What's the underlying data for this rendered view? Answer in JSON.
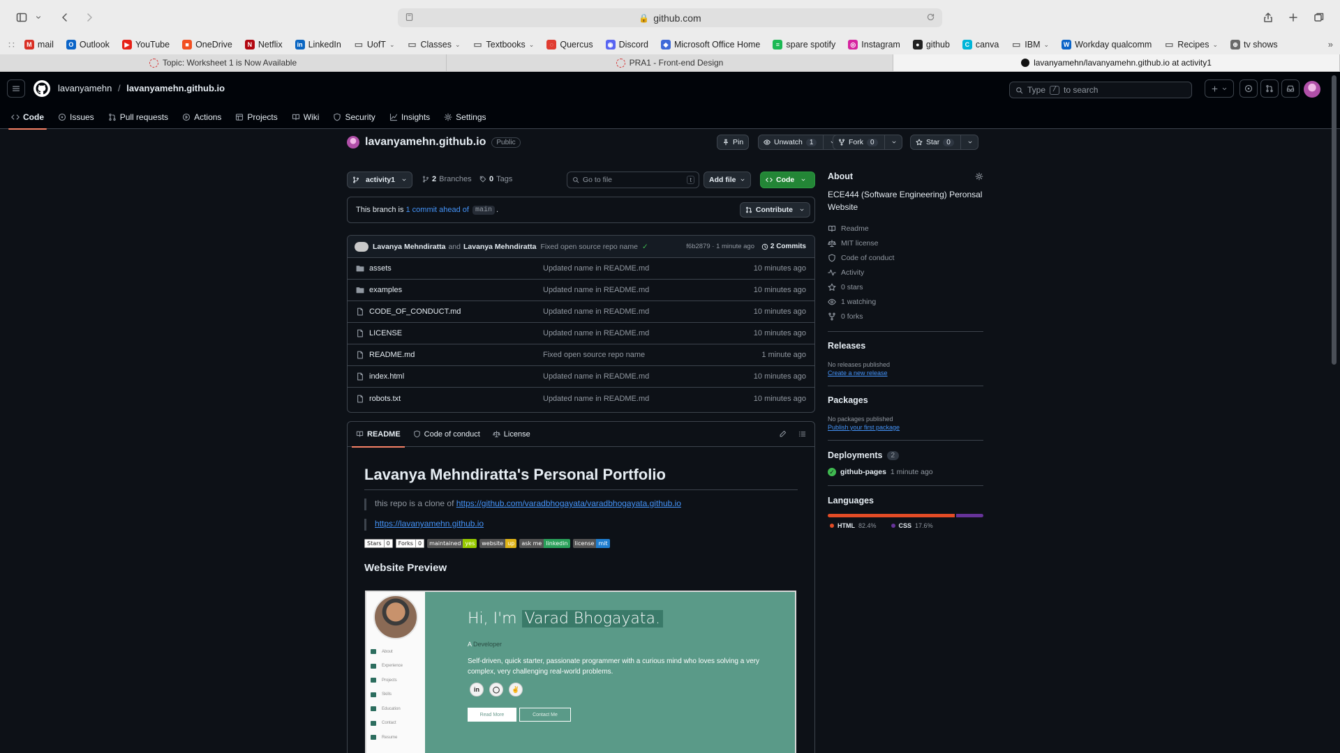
{
  "browser": {
    "address": "github.com",
    "bookmarks": [
      {
        "label": "mail",
        "color": "#d93025",
        "glyph": "M",
        "caret": false
      },
      {
        "label": "Outlook",
        "color": "#0a64c8",
        "glyph": "O",
        "caret": false
      },
      {
        "label": "YouTube",
        "color": "#e62117",
        "glyph": "▶",
        "caret": false
      },
      {
        "label": "OneDrive",
        "color": "#f25022",
        "glyph": "■",
        "caret": false
      },
      {
        "label": "Netflix",
        "color": "#b20710",
        "glyph": "N",
        "caret": false
      },
      {
        "label": "LinkedIn",
        "color": "#0a66c2",
        "glyph": "in",
        "caret": false
      },
      {
        "label": "UofT",
        "color": "#6a6a6a",
        "glyph": "▭",
        "caret": true
      },
      {
        "label": "Classes",
        "color": "#6a6a6a",
        "glyph": "▭",
        "caret": true
      },
      {
        "label": "Textbooks",
        "color": "#6a6a6a",
        "glyph": "▭",
        "caret": true
      },
      {
        "label": "Quercus",
        "color": "#e03c31",
        "glyph": "◌",
        "caret": false
      },
      {
        "label": "Discord",
        "color": "#5865f2",
        "glyph": "◉",
        "caret": false
      },
      {
        "label": "Microsoft Office Home",
        "color": "#3f6ad8",
        "glyph": "◆",
        "caret": false
      },
      {
        "label": "spare spotify",
        "color": "#1db954",
        "glyph": "≡",
        "caret": false
      },
      {
        "label": "Instagram",
        "color": "#d6249f",
        "glyph": "◎",
        "caret": false
      },
      {
        "label": "github",
        "color": "#222222",
        "glyph": "●",
        "caret": false
      },
      {
        "label": "canva",
        "color": "#00b5d8",
        "glyph": "C",
        "caret": false
      },
      {
        "label": "IBM",
        "color": "#6a6a6a",
        "glyph": "▭",
        "caret": true
      },
      {
        "label": "Workday qualcomm",
        "color": "#0a64c8",
        "glyph": "W",
        "caret": false
      },
      {
        "label": "Recipes",
        "color": "#6a6a6a",
        "glyph": "▭",
        "caret": true
      },
      {
        "label": "tv shows",
        "color": "#6a6a6a",
        "glyph": "⊕",
        "caret": false
      }
    ],
    "tabs": [
      {
        "label": "Topic: Worksheet 1 is Now Available",
        "active": false
      },
      {
        "label": "PRA1 - Front-end Design",
        "active": false
      },
      {
        "label": "lavanyamehn/lavanyamehn.github.io at activity1",
        "active": true
      }
    ]
  },
  "header": {
    "owner": "lavanyamehn",
    "separator": "/",
    "repo": "lavanyamehn.github.io",
    "search_prefix": "Type",
    "search_key": "/",
    "search_suffix": "to search"
  },
  "repo_nav": [
    {
      "label": "Code",
      "icon": "code-icon",
      "active": true
    },
    {
      "label": "Issues",
      "icon": "issue-icon",
      "active": false
    },
    {
      "label": "Pull requests",
      "icon": "pull-request-icon",
      "active": false
    },
    {
      "label": "Actions",
      "icon": "play-icon",
      "active": false
    },
    {
      "label": "Projects",
      "icon": "table-icon",
      "active": false
    },
    {
      "label": "Wiki",
      "icon": "book-icon",
      "active": false
    },
    {
      "label": "Security",
      "icon": "shield-icon",
      "active": false
    },
    {
      "label": "Insights",
      "icon": "graph-icon",
      "active": false
    },
    {
      "label": "Settings",
      "icon": "gear-icon",
      "active": false
    }
  ],
  "repo": {
    "name": "lavanyamehn.github.io",
    "visibility": "Public",
    "pin": "Pin",
    "unwatch": "Unwatch",
    "watch_count": "1",
    "fork": "Fork",
    "fork_count": "0",
    "star": "Star",
    "star_count": "0"
  },
  "toolbar": {
    "branch": "activity1",
    "branches_count": "2",
    "branches_label": "Branches",
    "tags_count": "0",
    "tags_label": "Tags",
    "goto_placeholder": "Go to file",
    "goto_key": "t",
    "add_file": "Add file",
    "code": "Code"
  },
  "branch_note": {
    "prefix": "This branch is",
    "link": "1 commit ahead of",
    "branch": "main",
    "suffix": ".",
    "contribute": "Contribute"
  },
  "commit": {
    "author1": "Lavanya Mehndiratta",
    "and": "and",
    "author2": "Lavanya Mehndiratta",
    "message": "Fixed open source repo name",
    "meta": "f6b2879 · 1 minute ago",
    "commits": "2 Commits"
  },
  "files": [
    {
      "name": "assets",
      "type": "dir",
      "message": "Updated name in README.md",
      "date": "10 minutes ago"
    },
    {
      "name": "examples",
      "type": "dir",
      "message": "Updated name in README.md",
      "date": "10 minutes ago"
    },
    {
      "name": "CODE_OF_CONDUCT.md",
      "type": "file",
      "message": "Updated name in README.md",
      "date": "10 minutes ago"
    },
    {
      "name": "LICENSE",
      "type": "file",
      "message": "Updated name in README.md",
      "date": "10 minutes ago"
    },
    {
      "name": "README.md",
      "type": "file",
      "message": "Fixed open source repo name",
      "date": "1 minute ago"
    },
    {
      "name": "index.html",
      "type": "file",
      "message": "Updated name in README.md",
      "date": "10 minutes ago"
    },
    {
      "name": "robots.txt",
      "type": "file",
      "message": "Updated name in README.md",
      "date": "10 minutes ago"
    }
  ],
  "readme": {
    "tabs": [
      "README",
      "Code of conduct",
      "License"
    ],
    "title": "Lavanya Mehndiratta's Personal Portfolio",
    "clone_text": "this repo is a clone of",
    "clone_link": "https://github.com/varadbhogayata/varadbhogayata.github.io",
    "site_link": "https://lavanyamehn.github.io",
    "badges": [
      {
        "l": "Stars",
        "r": "0",
        "kind": "gh",
        "color": "#ffffff"
      },
      {
        "l": "Forks",
        "r": "0",
        "kind": "gh",
        "color": "#ffffff"
      },
      {
        "l": "maintained",
        "r": "yes",
        "kind": "std",
        "color": "#97ca00"
      },
      {
        "l": "website",
        "r": "up",
        "kind": "std",
        "color": "#dfb317"
      },
      {
        "l": "ask me",
        "r": "linkedin",
        "kind": "std",
        "color": "#2aa05a"
      },
      {
        "l": "license",
        "r": "mit",
        "kind": "std",
        "color": "#1f7ed0"
      }
    ],
    "preview_heading": "Website Preview",
    "preview": {
      "hi": "Hi, I'm",
      "name": "Varad Bhogayata.",
      "a": "A",
      "role": "Developer",
      "desc": "Self-driven, quick starter, passionate programmer with a curious mind who loves solving a very complex, very challenging real-world problems.",
      "nav": [
        "About",
        "Experience",
        "Projects",
        "Skills",
        "Education",
        "Contact",
        "Resume"
      ],
      "social": [
        "in",
        "◯",
        "✌"
      ],
      "read_more": "Read More",
      "contact": "Contact Me"
    }
  },
  "sidebar": {
    "about_title": "About",
    "description": "ECE444 (Software Engineering) Peronsal Website",
    "links": [
      {
        "label": "Readme",
        "icon": "book-icon"
      },
      {
        "label": "MIT license",
        "icon": "law-icon"
      },
      {
        "label": "Code of conduct",
        "icon": "heart-shield-icon"
      },
      {
        "label": "Activity",
        "icon": "pulse-icon"
      },
      {
        "label": "0 stars",
        "icon": "star-icon"
      },
      {
        "label": "1 watching",
        "icon": "eye-icon"
      },
      {
        "label": "0 forks",
        "icon": "fork-icon"
      }
    ],
    "releases_title": "Releases",
    "releases_none": "No releases published",
    "releases_link": "Create a new release",
    "packages_title": "Packages",
    "packages_none": "No packages published",
    "packages_link": "Publish your first package",
    "deployments_title": "Deployments",
    "deployments_count": "2",
    "deployment_name": "github-pages",
    "deployment_time": "1 minute ago",
    "languages_title": "Languages",
    "languages": [
      {
        "name": "HTML",
        "percent": 82.4,
        "color": "#e34c26"
      },
      {
        "name": "CSS",
        "percent": 17.6,
        "color": "#663399"
      }
    ]
  }
}
